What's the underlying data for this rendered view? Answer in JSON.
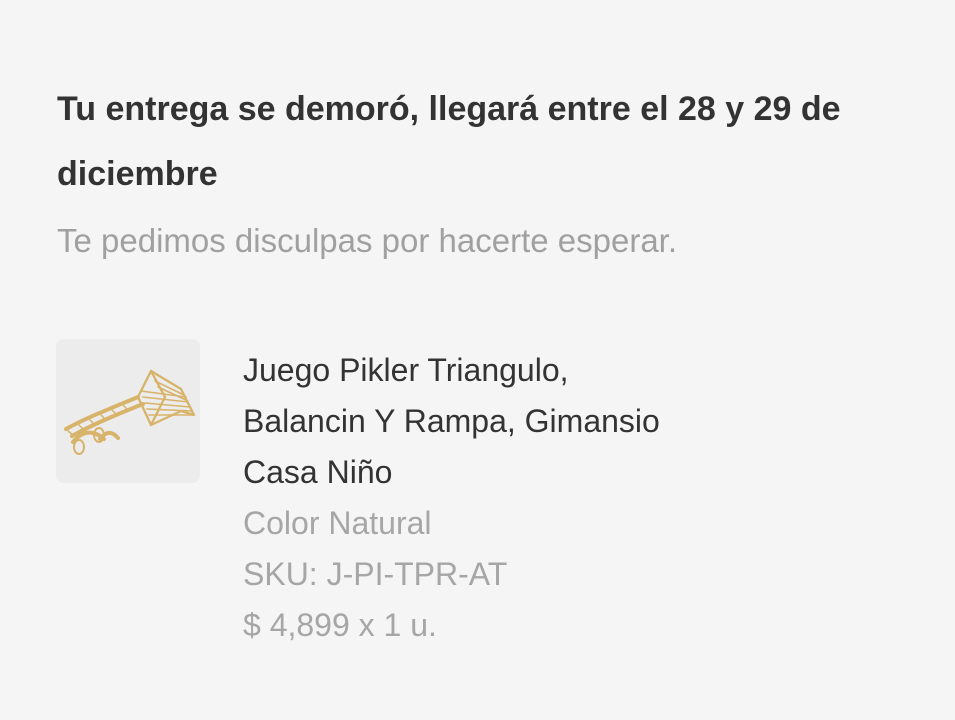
{
  "delivery": {
    "heading": "Tu entrega se demoró, llegará entre el 28 y 29 de diciembre",
    "subtitle": "Te pedimos disculpas por hacerte esperar."
  },
  "product": {
    "title_line1": "Juego Pikler Triangulo,",
    "title_line2": "Balancin Y Rampa, Gimansio",
    "title_line3": "Casa Niño",
    "variant": "Color Natural",
    "sku": "SKU: J-PI-TPR-AT",
    "price_quantity": "$ 4,899 x 1 u.",
    "image_icon": "pikler-triangle-ramp-icon"
  },
  "colors": {
    "background": "#f5f5f5",
    "primary_text": "#333333",
    "secondary_text": "#a6a6a6",
    "wood": "#d8b36a"
  }
}
